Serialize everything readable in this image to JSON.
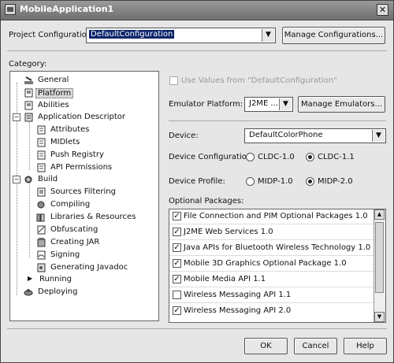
{
  "window": {
    "title": "MobileApplication1",
    "close_glyph": "✕"
  },
  "project_config": {
    "label": "Project Configuration:",
    "value": "DefaultConfiguration",
    "manage_button": "Manage Configurations..."
  },
  "category": {
    "label": "Category:",
    "items": [
      {
        "label": "General",
        "icon": "wrench-icon"
      },
      {
        "label": "Platform",
        "icon": "platform-icon"
      },
      {
        "label": "Abilities",
        "icon": "abilities-icon"
      },
      {
        "label": "Application Descriptor",
        "icon": "descriptor-icon"
      },
      {
        "label": "Attributes",
        "icon": "attributes-icon"
      },
      {
        "label": "MIDlets",
        "icon": "midlets-icon"
      },
      {
        "label": "Push Registry",
        "icon": "push-registry-icon"
      },
      {
        "label": "API Permissions",
        "icon": "permissions-icon"
      },
      {
        "label": "Build",
        "icon": "build-icon"
      },
      {
        "label": "Sources Filtering",
        "icon": "sources-icon"
      },
      {
        "label": "Compiling",
        "icon": "compiling-icon"
      },
      {
        "label": "Libraries & Resources",
        "icon": "libraries-icon"
      },
      {
        "label": "Obfuscating",
        "icon": "obfuscating-icon"
      },
      {
        "label": "Creating JAR",
        "icon": "jar-icon"
      },
      {
        "label": "Signing",
        "icon": "signing-icon"
      },
      {
        "label": "Generating Javadoc",
        "icon": "javadoc-icon"
      },
      {
        "label": "Running",
        "icon": "running-icon"
      },
      {
        "label": "Deploying",
        "icon": "deploying-icon"
      }
    ]
  },
  "platform": {
    "use_values_label": "Use Values from \"DefaultConfiguration\"",
    "emulator_label": "Emulator Platform:",
    "emulator_value": "J2ME ...",
    "manage_emulators": "Manage Emulators...",
    "device_label": "Device:",
    "device_value": "DefaultColorPhone",
    "device_config_label": "Device Configuration:",
    "cldc10": "CLDC-1.0",
    "cldc11": "CLDC-1.1",
    "device_profile_label": "Device Profile:",
    "midp10": "MIDP-1.0",
    "midp20": "MIDP-2.0",
    "optional_label": "Optional Packages:",
    "packages": [
      {
        "label": "File Connection and PIM Optional Packages 1.0",
        "checked": true
      },
      {
        "label": "J2ME Web Services 1.0",
        "checked": true
      },
      {
        "label": "Java APIs for Bluetooth Wireless Technology 1.0",
        "checked": true
      },
      {
        "label": "Mobile 3D Graphics Optional Package 1.0",
        "checked": true
      },
      {
        "label": "Mobile Media API 1.1",
        "checked": true
      },
      {
        "label": "Wireless Messaging API 1.1",
        "checked": false
      },
      {
        "label": "Wireless Messaging API 2.0",
        "checked": true
      }
    ]
  },
  "footer": {
    "ok": "OK",
    "cancel": "Cancel",
    "help": "Help"
  },
  "glyphs": {
    "check": "✓",
    "down": "▼",
    "up": "▲",
    "expanded": "−",
    "collapsed": "▶"
  }
}
